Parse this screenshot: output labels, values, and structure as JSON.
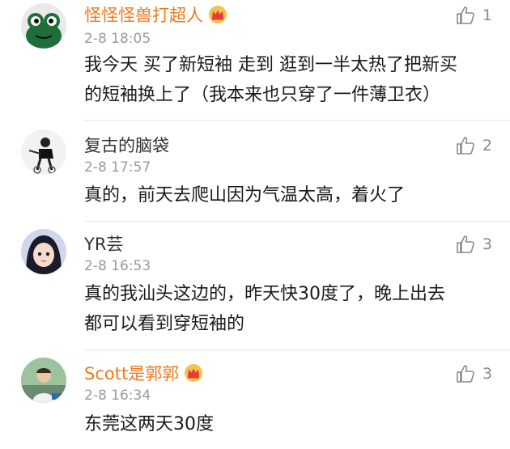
{
  "comments": [
    {
      "user": "怪怪怪兽打超人",
      "vip": true,
      "time": "2-8 18:05",
      "likes": "1",
      "lines": [
        "我今天 买了新短袖 走到 逛到一半太热了把新买",
        "的短袖换上了（我本来也只穿了一件薄卫衣）"
      ]
    },
    {
      "user": "复古的脑袋",
      "vip": false,
      "time": "2-8 17:57",
      "likes": "2",
      "lines": [
        "真的，前天去爬山因为气温太高，着火了"
      ]
    },
    {
      "user": "YR芸",
      "vip": false,
      "time": "2-8 16:53",
      "likes": "3",
      "lines": [
        "真的我汕头这边的，昨天快30度了，晚上出去",
        "都可以看到穿短袖的"
      ]
    },
    {
      "user": "Scott是郭郭",
      "vip": true,
      "time": "2-8 16:34",
      "likes": "3",
      "lines": [
        "东莞这两天30度"
      ]
    }
  ],
  "colors": {
    "vip_name": "#ee7a1f",
    "normal_name": "#333333",
    "time": "#9a9a9a",
    "divider": "#e6e6e6"
  },
  "icons": {
    "like": "thumbs-up-icon",
    "vip": "crown-badge-icon"
  }
}
